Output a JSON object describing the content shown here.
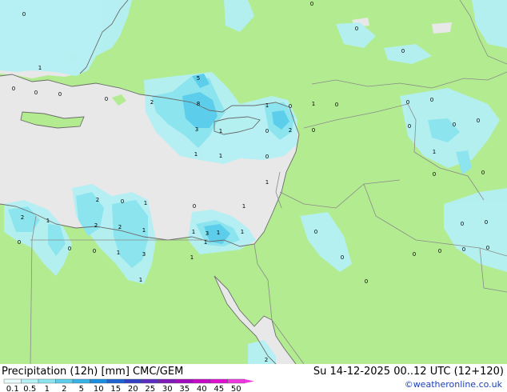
{
  "title": "Precipitation (12h) [mm] CMC/GEM",
  "valid_time": "Su 14-12-2025 00..12 UTC (12+120)",
  "copyright": "©weatheronline.co.uk",
  "legend": {
    "labels": [
      "0.1",
      "0.5",
      "1",
      "2",
      "5",
      "10",
      "15",
      "20",
      "25",
      "30",
      "35",
      "40",
      "45",
      "50"
    ],
    "colors": [
      "#e8fcfc",
      "#b4f0f4",
      "#8ce4ee",
      "#5ccdea",
      "#36b2e6",
      "#1a8ee0",
      "#1f64d0",
      "#3341c4",
      "#5a2ec0",
      "#7d1cba",
      "#a00ec0",
      "#c40ac4",
      "#e010d2",
      "#f038e0"
    ]
  },
  "colors": {
    "land": "#b3ec90",
    "sea": "#e8e8e8",
    "border": "#8a8a8a",
    "coast": "#6b6b6b",
    "precip_light": "#b4f0f4",
    "precip_mid": "#8ce4ee",
    "precip_heavy": "#5ccdea"
  },
  "station_values": [
    {
      "value": "1"
    },
    {
      "value": "0"
    },
    {
      "value": "0"
    },
    {
      "value": "0"
    },
    {
      "value": "0"
    },
    {
      "value": "5"
    },
    {
      "value": "2"
    },
    {
      "value": "8"
    },
    {
      "value": "3"
    },
    {
      "value": "1"
    },
    {
      "value": "1"
    },
    {
      "value": "0"
    },
    {
      "value": "1"
    },
    {
      "value": "0"
    },
    {
      "value": "2"
    },
    {
      "value": "0"
    },
    {
      "value": "1"
    },
    {
      "value": "1"
    },
    {
      "value": "0"
    },
    {
      "value": "0"
    },
    {
      "value": "1"
    },
    {
      "value": "1"
    },
    {
      "value": "0"
    },
    {
      "value": "1"
    },
    {
      "value": "2"
    },
    {
      "value": "0"
    },
    {
      "value": "1"
    },
    {
      "value": "2"
    },
    {
      "value": "1"
    },
    {
      "value": "2"
    },
    {
      "value": "2"
    },
    {
      "value": "1"
    },
    {
      "value": "0"
    },
    {
      "value": "1"
    },
    {
      "value": "0"
    },
    {
      "value": "0"
    },
    {
      "value": "1"
    },
    {
      "value": "3"
    },
    {
      "value": "1"
    },
    {
      "value": "1"
    },
    {
      "value": "1"
    },
    {
      "value": "3"
    },
    {
      "value": "1"
    },
    {
      "value": "0"
    },
    {
      "value": "0"
    },
    {
      "value": "0"
    },
    {
      "value": "0"
    },
    {
      "value": "0"
    },
    {
      "value": "0"
    },
    {
      "value": "0"
    },
    {
      "value": "0"
    },
    {
      "value": "0"
    },
    {
      "value": "0"
    },
    {
      "value": "1"
    },
    {
      "value": "0"
    },
    {
      "value": "0"
    },
    {
      "value": "0"
    },
    {
      "value": "0"
    },
    {
      "value": "0"
    },
    {
      "value": "2"
    },
    {
      "value": "0"
    },
    {
      "value": "0"
    },
    {
      "value": "0"
    },
    {
      "value": "0"
    },
    {
      "value": "0"
    }
  ]
}
